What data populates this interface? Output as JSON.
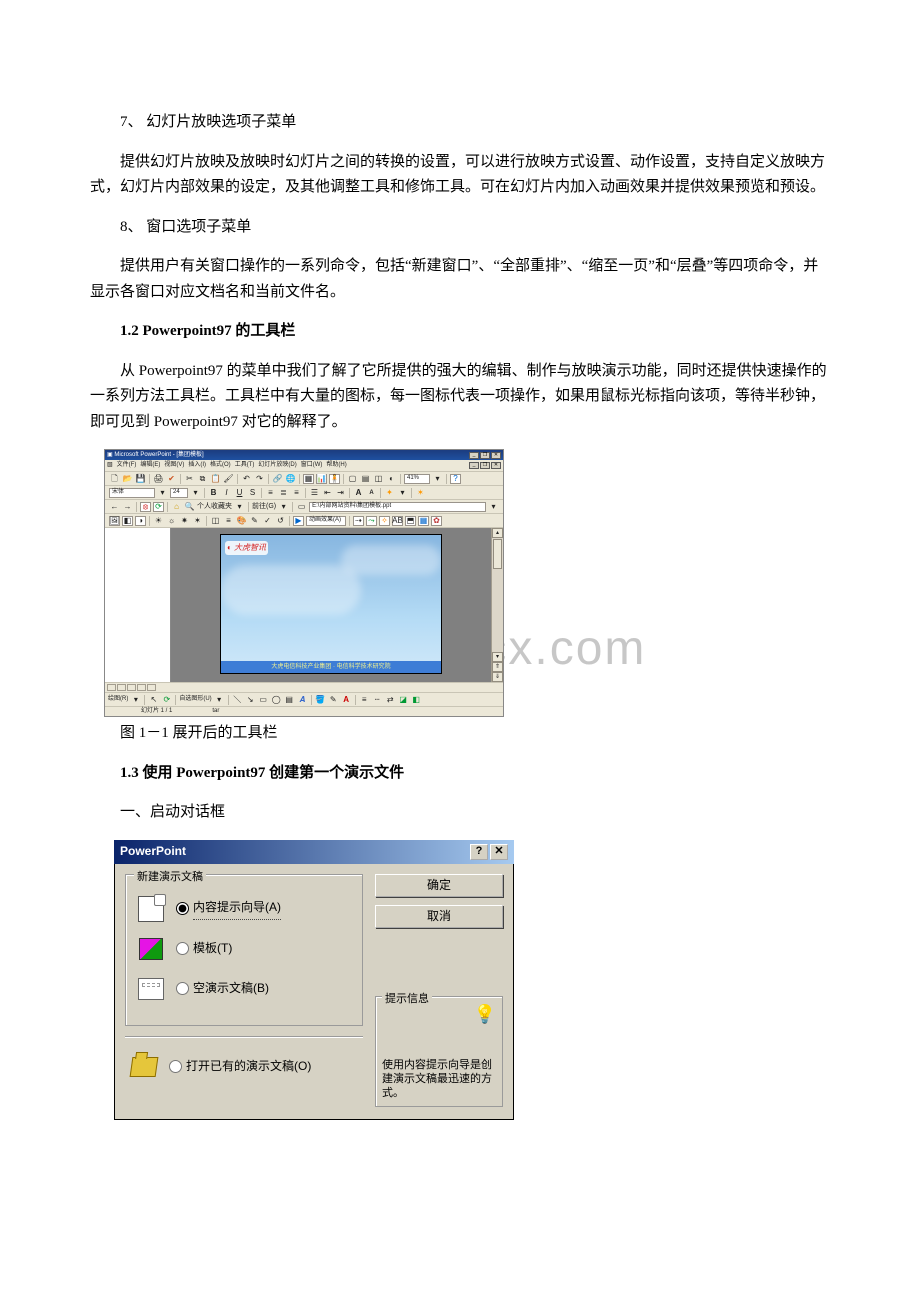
{
  "section7": {
    "title": "7、 幻灯片放映选项子菜单",
    "body": "提供幻灯片放映及放映时幻灯片之间的转换的设置，可以进行放映方式设置、动作设置，支持自定义放映方式，幻灯片内部效果的设定，及其他调整工具和修饰工具。可在幻灯片内加入动画效果并提供效果预览和预设。"
  },
  "section8": {
    "title": "8、 窗口选项子菜单",
    "body": "提供用户有关窗口操作的一系列命令，包括“新建窗口”、“全部重排”、“缩至一页”和“层叠”等四项命令，并显示各窗口对应文档名和当前文件名。"
  },
  "h12": "1.2 Powerpoint97 的工具栏",
  "p12": "从 Powerpoint97 的菜单中我们了解了它所提供的强大的编辑、制作与放映演示功能，同时还提供快速操作的一系列方法工具栏。工具栏中有大量的图标，每一图标代表一项操作，如果用鼠标光标指向该项，等待半秒钟，即可见到 Powerpoint97 对它的解释了。",
  "fig1": {
    "title": "Microsoft PowerPoint - [集团模板]",
    "menus": [
      "文件(F)",
      "编辑(E)",
      "视图(V)",
      "插入(I)",
      "格式(O)",
      "工具(T)",
      "幻灯片放映(D)",
      "窗口(W)",
      "帮助(H)"
    ],
    "font_name": "宋体",
    "font_size": "24",
    "zoom": "41%",
    "favorites": "个人收藏夹",
    "goto": "前往(G)",
    "address": "E:\\内部网站资料\\集团模板.ppt",
    "draw": "绘图(R)",
    "autoshapes": "自选图形(U)",
    "slide_logo": "◐ 大虎智讯",
    "slide_caption": "大虎电信科技产业集团 · 电信科学技术研究院",
    "status_left": "幻灯片 1 / 1",
    "status_right": "tar",
    "caption": "图 1－1 展开后的工具栏"
  },
  "h13": "1.3 使用 Powerpoint97 创建第一个演示文件",
  "p13a": "一、启动对话框",
  "dlg": {
    "title": "PowerPoint",
    "group_label": "新建演示文稿",
    "opt_wizard": "内容提示向导(A)",
    "opt_template": "模板(T)",
    "opt_blank": "空演示文稿(B)",
    "opt_open": "打开已有的演示文稿(O)",
    "ok": "确定",
    "cancel": "取消",
    "tip_label": "提示信息",
    "tip_body": "使用内容提示向导是创建演示文稿最迅速的方式。"
  },
  "watermark": "www.bdocx.com"
}
